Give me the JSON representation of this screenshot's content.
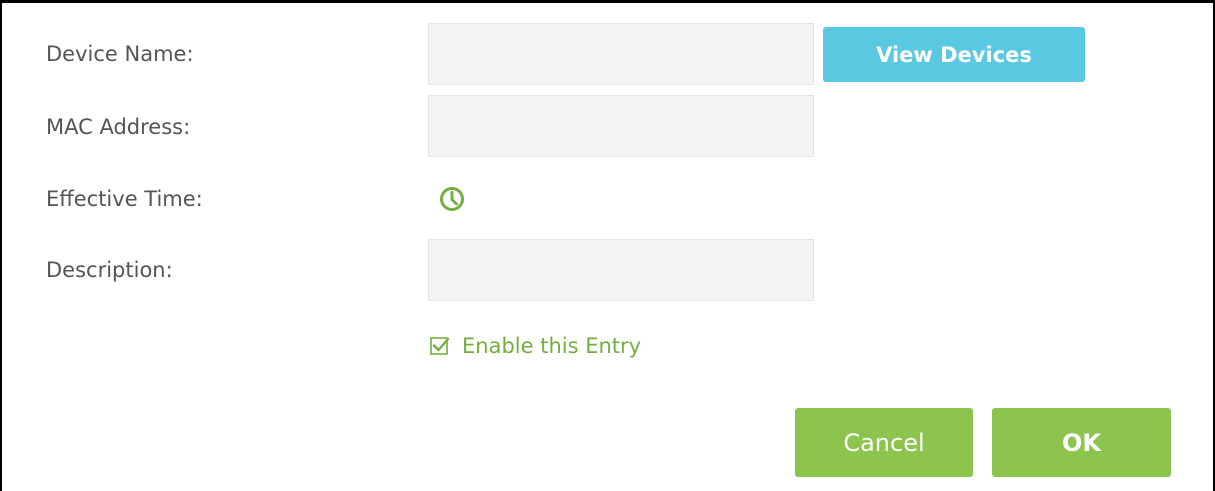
{
  "form": {
    "device_name": {
      "label": "Device Name:",
      "value": "",
      "placeholder": ""
    },
    "mac_address": {
      "label": "MAC Address:",
      "value": "",
      "placeholder": ""
    },
    "effective_time": {
      "label": "Effective Time:",
      "icon": "clock-icon"
    },
    "description": {
      "label": "Description:",
      "value": "",
      "placeholder": ""
    },
    "enable_entry": {
      "label": "Enable this Entry",
      "checked": true
    }
  },
  "buttons": {
    "view_devices": "View Devices",
    "cancel": "Cancel",
    "ok": "OK"
  },
  "colors": {
    "view_devices_button": "#5bc8e2",
    "action_button": "#8dc44e",
    "accent_green": "#75ae3f",
    "label_text": "#555555",
    "field_background": "#f3f3f3"
  }
}
